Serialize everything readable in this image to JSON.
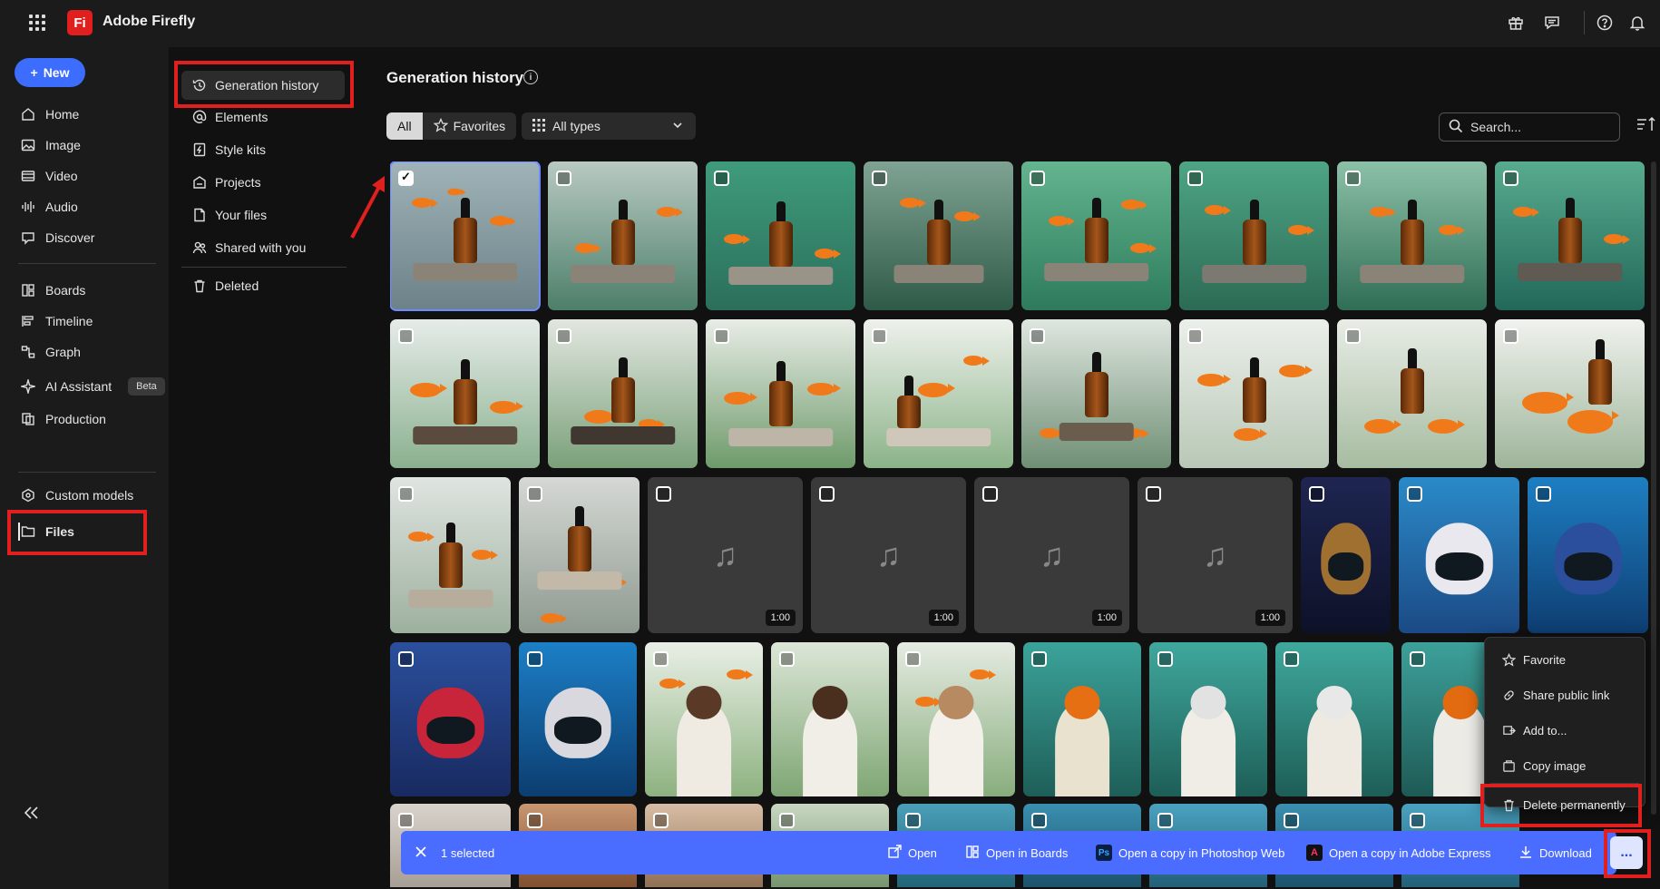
{
  "app": {
    "logo": "Fi",
    "title": "Adobe Firefly"
  },
  "header_icons": [
    "gift-icon",
    "chat-icon",
    "help-icon",
    "bell-icon"
  ],
  "rail": {
    "new_label": "New",
    "items": [
      {
        "label": "Home",
        "icon": "home-icon"
      },
      {
        "label": "Image",
        "icon": "image-icon"
      },
      {
        "label": "Video",
        "icon": "video-icon"
      },
      {
        "label": "Audio",
        "icon": "audio-icon"
      },
      {
        "label": "Discover",
        "icon": "discover-icon"
      },
      {
        "label": "Boards",
        "icon": "boards-icon"
      },
      {
        "label": "Timeline",
        "icon": "timeline-icon"
      },
      {
        "label": "Graph",
        "icon": "graph-icon"
      },
      {
        "label": "AI Assistant",
        "icon": "assistant-icon"
      },
      {
        "label": "Production",
        "icon": "production-icon"
      },
      {
        "label": "Custom models",
        "icon": "custom-models-icon"
      },
      {
        "label": "Files",
        "icon": "folder-icon"
      }
    ],
    "beta_label": "Beta",
    "collapse_icon": "collapse-icon"
  },
  "subnav": {
    "items": [
      {
        "label": "Generation history",
        "icon": "history-icon"
      },
      {
        "label": "Elements",
        "icon": "at-icon"
      },
      {
        "label": "Style kits",
        "icon": "style-kit-icon"
      },
      {
        "label": "Projects",
        "icon": "projects-icon"
      },
      {
        "label": "Your files",
        "icon": "file-icon"
      },
      {
        "label": "Shared with you",
        "icon": "shared-icon"
      },
      {
        "label": "Deleted",
        "icon": "trash-icon"
      }
    ]
  },
  "main": {
    "title": "Generation history",
    "filter_all": "All",
    "filter_favorites": "Favorites",
    "types_label": "All types",
    "search_placeholder": "Search...",
    "audio_duration": "1:00"
  },
  "menu": {
    "items": [
      {
        "label": "Favorite",
        "icon": "star-icon"
      },
      {
        "label": "Share public link",
        "icon": "link-icon"
      },
      {
        "label": "Add to...",
        "icon": "add-to-icon"
      },
      {
        "label": "Copy image",
        "icon": "copy-icon"
      },
      {
        "label": "Delete permanently",
        "icon": "trash-icon"
      }
    ]
  },
  "actionbar": {
    "selected": "1 selected",
    "open": "Open",
    "open_boards": "Open in Boards",
    "ps_badge": "Ps",
    "open_ps": "Open a copy in Photoshop Web",
    "open_express": "Open a copy in Adobe Express",
    "download": "Download",
    "more": "..."
  },
  "colors": {
    "accent": "#4a6cff",
    "highlight": "#e01f1f",
    "brand": "#e01f1f"
  }
}
